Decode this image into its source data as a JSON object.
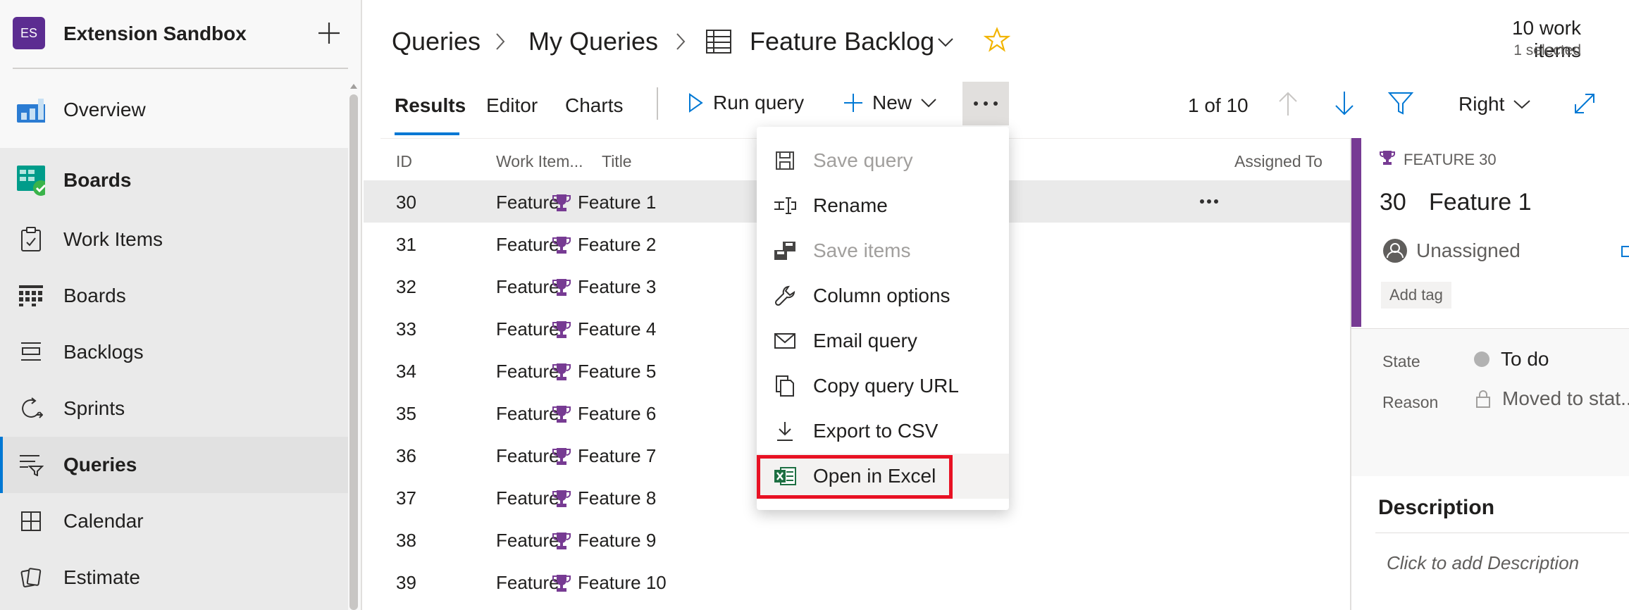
{
  "project": {
    "initials": "ES",
    "name": "Extension Sandbox",
    "accent": "#5c2d91"
  },
  "sidebar": {
    "items": [
      {
        "label": "Overview"
      },
      {
        "label": "Boards"
      },
      {
        "label": "Work Items"
      },
      {
        "label": "Boards"
      },
      {
        "label": "Backlogs"
      },
      {
        "label": "Sprints"
      },
      {
        "label": "Queries"
      },
      {
        "label": "Calendar"
      },
      {
        "label": "Estimate"
      }
    ]
  },
  "breadcrumb": {
    "queries": "Queries",
    "my_queries": "My Queries",
    "current": "Feature Backlog"
  },
  "summary": {
    "count": "10 work items",
    "selected": "1 selected"
  },
  "tabs": [
    "Results",
    "Editor",
    "Charts"
  ],
  "toolbar": {
    "run": "Run query",
    "new": "New",
    "pager": "1 of 10",
    "pane": "Right"
  },
  "grid": {
    "headers": {
      "id": "ID",
      "type": "Work Item...",
      "title": "Title",
      "assigned": "Assigned To"
    },
    "rows": [
      {
        "id": "30",
        "type": "Feature",
        "title": "Feature 1"
      },
      {
        "id": "31",
        "type": "Feature",
        "title": "Feature 2"
      },
      {
        "id": "32",
        "type": "Feature",
        "title": "Feature 3"
      },
      {
        "id": "33",
        "type": "Feature",
        "title": "Feature 4"
      },
      {
        "id": "34",
        "type": "Feature",
        "title": "Feature 5"
      },
      {
        "id": "35",
        "type": "Feature",
        "title": "Feature 6"
      },
      {
        "id": "36",
        "type": "Feature",
        "title": "Feature 7"
      },
      {
        "id": "37",
        "type": "Feature",
        "title": "Feature 8"
      },
      {
        "id": "38",
        "type": "Feature",
        "title": "Feature 9"
      },
      {
        "id": "39",
        "type": "Feature",
        "title": "Feature 10"
      }
    ]
  },
  "menu": {
    "items": [
      {
        "label": "Save query",
        "icon": "save-icon",
        "disabled": true
      },
      {
        "label": "Rename",
        "icon": "rename-icon",
        "disabled": false
      },
      {
        "label": "Save items",
        "icon": "save-items-icon",
        "disabled": true
      },
      {
        "label": "Column options",
        "icon": "wrench-icon",
        "disabled": false
      },
      {
        "label": "Email query",
        "icon": "mail-icon",
        "disabled": false
      },
      {
        "label": "Copy query URL",
        "icon": "copy-icon",
        "disabled": false
      },
      {
        "label": "Export to CSV",
        "icon": "download-icon",
        "disabled": false
      },
      {
        "label": "Open in Excel",
        "icon": "excel-icon",
        "disabled": false
      }
    ]
  },
  "detail": {
    "type": "FEATURE 30",
    "id": "30",
    "title": "Feature 1",
    "assignee": "Unassigned",
    "add_tag": "Add tag",
    "state_label": "State",
    "state_value": "To do",
    "reason_label": "Reason",
    "reason_value": "Moved to stat...",
    "description_header": "Description",
    "description_placeholder": "Click to add Description"
  },
  "colors": {
    "accent": "#0078d4",
    "feature_purple": "#773b93",
    "highlight_red": "#e81123",
    "star": "#f2b400"
  }
}
